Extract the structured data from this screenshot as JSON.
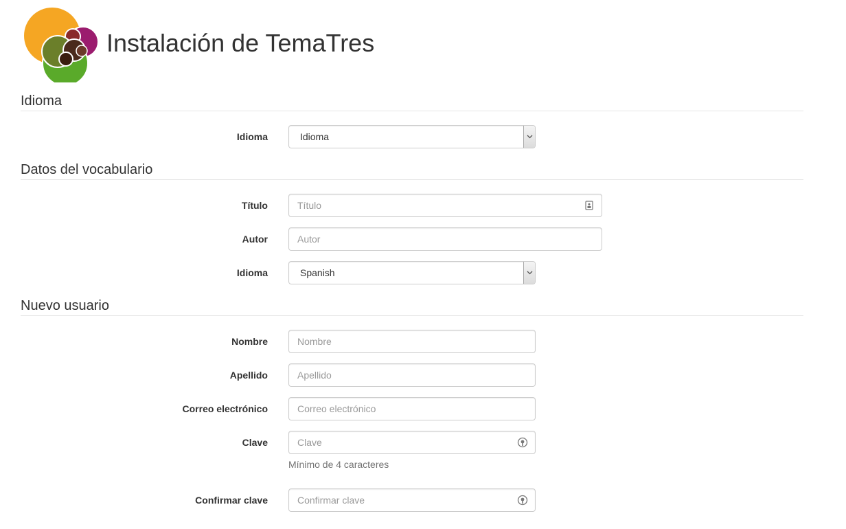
{
  "header": {
    "title": "Instalación de TemaTres",
    "logo_icon": "tematres-logo-icon"
  },
  "sections": {
    "language": {
      "title": "Idioma",
      "field_label": "Idioma",
      "field_value": "Idioma"
    },
    "vocabulary": {
      "title": "Datos del vocabulario",
      "titulo_label": "Título",
      "titulo_placeholder": "Título",
      "autor_label": "Autor",
      "autor_placeholder": "Autor",
      "idioma_label": "Idioma",
      "idioma_value": "Spanish"
    },
    "new_user": {
      "title": "Nuevo usuario",
      "nombre_label": "Nombre",
      "nombre_placeholder": "Nombre",
      "apellido_label": "Apellido",
      "apellido_placeholder": "Apellido",
      "correo_label": "Correo electrónico",
      "correo_placeholder": "Correo electrónico",
      "clave_label": "Clave",
      "clave_placeholder": "Clave",
      "clave_help": "Mínimo de 4 caracteres",
      "confirmar_label": "Confirmar clave",
      "confirmar_placeholder": "Confirmar clave"
    }
  },
  "colors": {
    "logo_orange": "#f5a623",
    "logo_purple": "#9b1c6e",
    "logo_olive": "#6b7f2a",
    "logo_green": "#5aaa2a",
    "logo_brown": "#4a2a1c",
    "logo_dark": "#3a1e10",
    "logo_red": "#8a2a2a",
    "border": "#cccccc",
    "placeholder": "#999999"
  }
}
